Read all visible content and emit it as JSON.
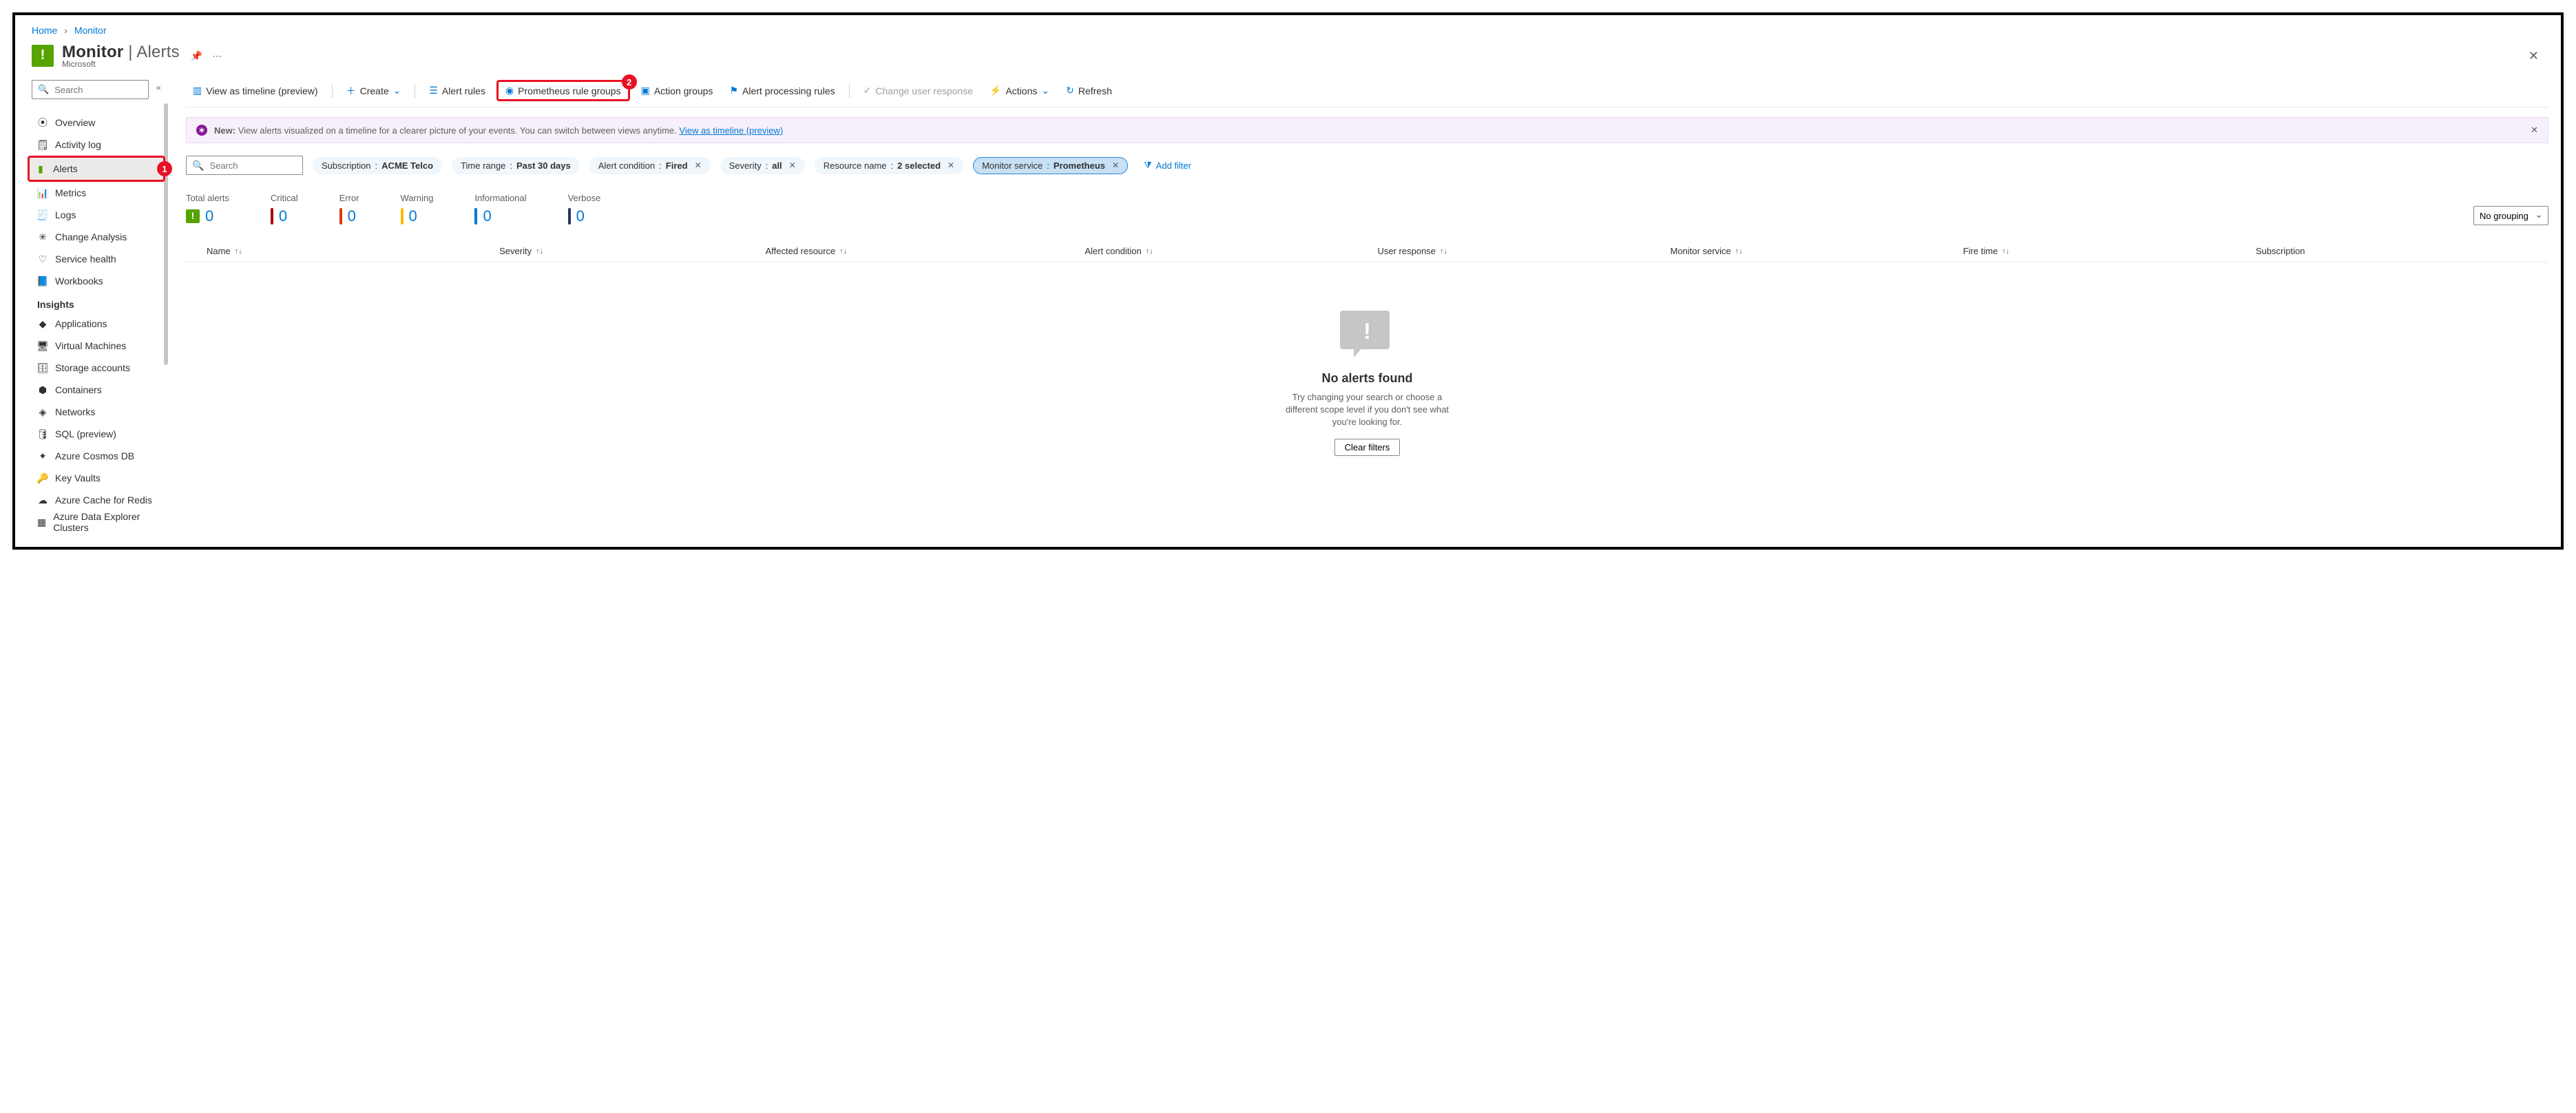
{
  "breadcrumb": {
    "home": "Home",
    "monitor": "Monitor"
  },
  "header": {
    "service": "Monitor",
    "page": "Alerts",
    "publisher": "Microsoft"
  },
  "sidebar": {
    "search_placeholder": "Search",
    "items": [
      {
        "icon": "⦿",
        "label": "Overview"
      },
      {
        "icon": "🗒",
        "label": "Activity log"
      },
      {
        "icon": "▮",
        "label": "Alerts",
        "active": true
      },
      {
        "icon": "📊",
        "label": "Metrics"
      },
      {
        "icon": "🧾",
        "label": "Logs"
      },
      {
        "icon": "✳",
        "label": "Change Analysis"
      },
      {
        "icon": "♡",
        "label": "Service health"
      },
      {
        "icon": "📘",
        "label": "Workbooks"
      }
    ],
    "insights_label": "Insights",
    "insights": [
      {
        "icon": "◆",
        "label": "Applications"
      },
      {
        "icon": "🖥",
        "label": "Virtual Machines"
      },
      {
        "icon": "🗄",
        "label": "Storage accounts"
      },
      {
        "icon": "⬢",
        "label": "Containers"
      },
      {
        "icon": "◈",
        "label": "Networks"
      },
      {
        "icon": "🛢",
        "label": "SQL (preview)"
      },
      {
        "icon": "✦",
        "label": "Azure Cosmos DB"
      },
      {
        "icon": "🔑",
        "label": "Key Vaults"
      },
      {
        "icon": "☁",
        "label": "Azure Cache for Redis"
      },
      {
        "icon": "▦",
        "label": "Azure Data Explorer Clusters"
      }
    ]
  },
  "toolbar": {
    "timeline": "View as timeline (preview)",
    "create": "Create",
    "alert_rules": "Alert rules",
    "prom_rules": "Prometheus rule groups",
    "action_groups": "Action groups",
    "processing_rules": "Alert processing rules",
    "change_user": "Change user response",
    "actions": "Actions",
    "refresh": "Refresh"
  },
  "banner": {
    "tag": "New:",
    "text": "View alerts visualized on a timeline for a clearer picture of your events. You can switch between views anytime.",
    "link": "View as timeline (preview)"
  },
  "filters": {
    "search_placeholder": "Search",
    "subscription": {
      "label": "Subscription",
      "value": "ACME Telco"
    },
    "time_range": {
      "label": "Time range",
      "value": "Past 30 days"
    },
    "condition": {
      "label": "Alert condition",
      "value": "Fired",
      "removable": true
    },
    "severity": {
      "label": "Severity",
      "value": "all",
      "removable": true
    },
    "resource": {
      "label": "Resource name",
      "value": "2 selected",
      "removable": true
    },
    "monitor": {
      "label": "Monitor service",
      "value": "Prometheus",
      "removable": true,
      "selected": true
    },
    "add": "Add filter"
  },
  "summary": {
    "total": {
      "label": "Total alerts",
      "value": "0"
    },
    "critical": {
      "label": "Critical",
      "value": "0",
      "color": "#a80000"
    },
    "error": {
      "label": "Error",
      "value": "0",
      "color": "#d83b01"
    },
    "warning": {
      "label": "Warning",
      "value": "0",
      "color": "#ffb900"
    },
    "info": {
      "label": "Informational",
      "value": "0",
      "color": "#0078d4"
    },
    "verbose": {
      "label": "Verbose",
      "value": "0",
      "color": "#243a5e"
    },
    "grouping": "No grouping"
  },
  "columns": {
    "name": "Name",
    "severity": "Severity",
    "resource": "Affected resource",
    "condition": "Alert condition",
    "user": "User response",
    "monitor": "Monitor service",
    "fire": "Fire time",
    "sub": "Subscription"
  },
  "empty": {
    "title": "No alerts found",
    "text": "Try changing your search or choose a different scope level if you don't see what you're looking for.",
    "button": "Clear filters"
  },
  "callouts": {
    "one": "1",
    "two": "2"
  }
}
